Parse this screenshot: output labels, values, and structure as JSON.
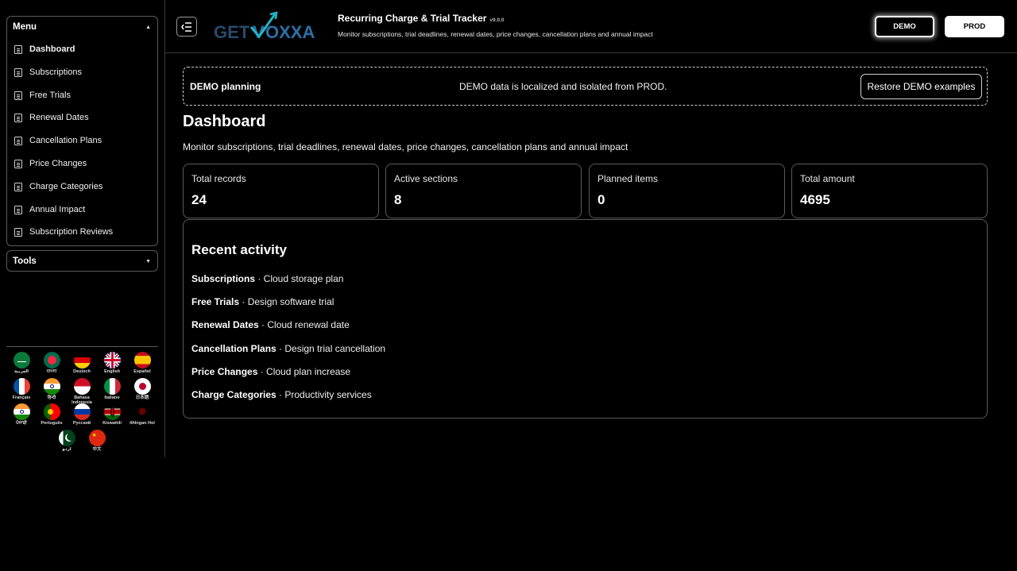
{
  "app": {
    "title": "Recurring Charge & Trial Tracker",
    "version": "v9.0.0",
    "subtitle": "Monitor subscriptions, trial deadlines, renewal dates, price changes, cancellation plans and annual impact",
    "logo_text": "GETVOXXA"
  },
  "env": {
    "demo_label": "DEMO",
    "prod_label": "PROD",
    "active": "DEMO"
  },
  "sidebar": {
    "menu_title": "Menu",
    "tools_title": "Tools",
    "items": [
      {
        "label": "Dashboard",
        "active": true
      },
      {
        "label": "Subscriptions"
      },
      {
        "label": "Free Trials"
      },
      {
        "label": "Renewal Dates"
      },
      {
        "label": "Cancellation Plans"
      },
      {
        "label": "Price Changes"
      },
      {
        "label": "Charge Categories"
      },
      {
        "label": "Annual Impact"
      },
      {
        "label": "Subscription Reviews"
      }
    ],
    "languages": [
      {
        "label": "العربية",
        "icon": "flag-saudi-arabia-icon"
      },
      {
        "label": "বাংলা",
        "icon": "flag-bangladesh-icon"
      },
      {
        "label": "Deutsch",
        "icon": "flag-germany-icon"
      },
      {
        "label": "English",
        "icon": "flag-uk-icon"
      },
      {
        "label": "Español",
        "icon": "flag-spain-icon"
      },
      {
        "label": "Français",
        "icon": "flag-france-icon"
      },
      {
        "label": "हिन्दी",
        "icon": "flag-india-icon"
      },
      {
        "label": "Bahasa Indonesia",
        "icon": "flag-indonesia-icon"
      },
      {
        "label": "Italiano",
        "icon": "flag-italy-icon"
      },
      {
        "label": "日本語",
        "icon": "flag-japan-icon"
      },
      {
        "label": "ਪੰਜਾਬੀ",
        "icon": "flag-india-icon"
      },
      {
        "label": "Português",
        "icon": "flag-portugal-icon"
      },
      {
        "label": "Русский",
        "icon": "flag-russia-icon"
      },
      {
        "label": "Kiswahili",
        "icon": "flag-kenya-icon"
      },
      {
        "label": "tlhIngan Hol",
        "icon": "klingon-emblem-icon"
      },
      {
        "label": "اردو",
        "icon": "flag-pakistan-icon"
      },
      {
        "label": "中文",
        "icon": "flag-china-icon"
      }
    ]
  },
  "banner": {
    "label": "DEMO planning",
    "message": "DEMO data is localized and isolated from PROD.",
    "restore_label": "Restore DEMO examples"
  },
  "page": {
    "title": "Dashboard",
    "subtitle": "Monitor subscriptions, trial deadlines, renewal dates, price changes, cancellation plans and annual impact"
  },
  "stats": [
    {
      "label": "Total records",
      "value": "24"
    },
    {
      "label": "Active sections",
      "value": "8"
    },
    {
      "label": "Planned items",
      "value": "0"
    },
    {
      "label": "Total amount",
      "value": "4695"
    }
  ],
  "activity": {
    "title": "Recent activity",
    "items": [
      {
        "section": "Subscriptions",
        "text": " · Cloud storage plan"
      },
      {
        "section": "Free Trials",
        "text": " · Design software trial"
      },
      {
        "section": "Renewal Dates",
        "text": " · Cloud renewal date"
      },
      {
        "section": "Cancellation Plans",
        "text": " · Design trial cancellation"
      },
      {
        "section": "Price Changes",
        "text": " · Cloud plan increase"
      },
      {
        "section": "Charge Categories",
        "text": " · Productivity services"
      }
    ]
  }
}
